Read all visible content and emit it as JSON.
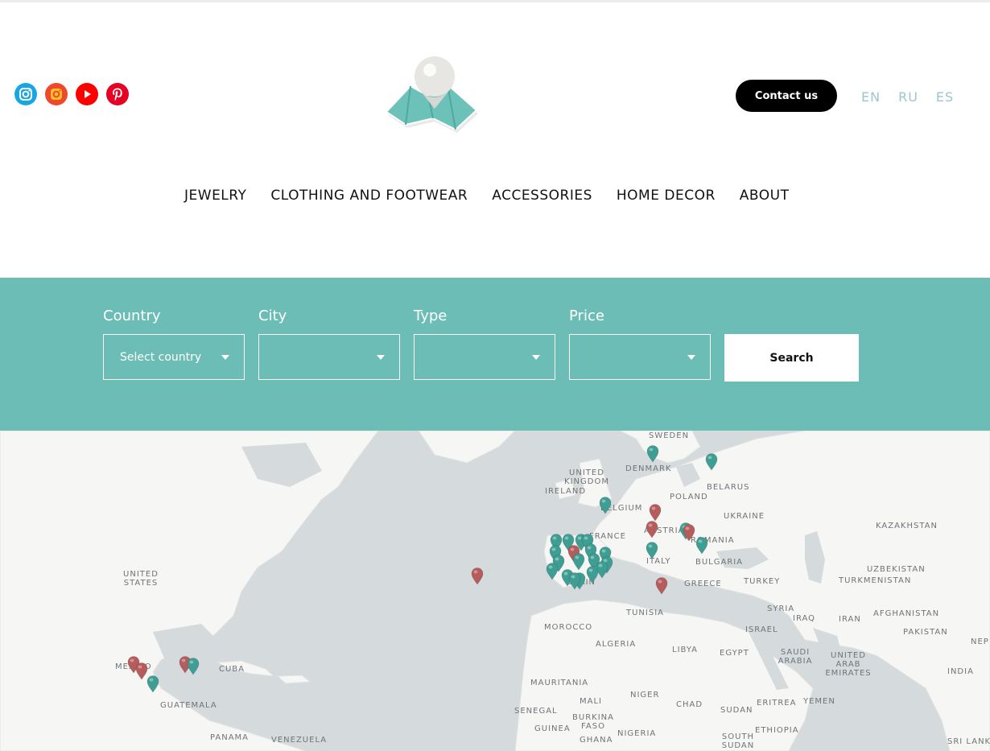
{
  "header": {
    "contact_label": "Contact us",
    "languages": [
      "EN",
      "RU",
      "ES"
    ]
  },
  "socials": [
    "instagram-icon",
    "instagram-color-icon",
    "youtube-icon",
    "pinterest-icon"
  ],
  "nav": [
    "JEWELRY",
    "CLOTHING AND FOOTWEAR",
    "ACCESSORIES",
    "HOME DECOR",
    "ABOUT"
  ],
  "filters": {
    "country_label": "Country",
    "country_value": "Select country",
    "city_label": "City",
    "city_value": "",
    "type_label": "Type",
    "type_value": "",
    "price_label": "Price",
    "price_value": "",
    "search_label": "Search"
  },
  "colors": {
    "accent": "#6dbdb7",
    "pin_teal": "#3f9e93",
    "pin_red": "#b65c5c",
    "map_water": "#d5dadd",
    "map_land": "#f6f6f4"
  },
  "map": {
    "labels": [
      "SWEDEN",
      "DENMARK",
      "UNITED KINGDOM",
      "IRELAND",
      "BELARUS",
      "POLAND",
      "BELGIUM",
      "UKRAINE",
      "KAZAKHSTAN",
      "FRANCE",
      "AUSTRIA",
      "ROMANIA",
      "BULGARIA",
      "ITALY",
      "UZBEKISTAN",
      "TURKMENISTAN",
      "UNITED STATES",
      "TURKEY",
      "GREECE",
      "SPAIN",
      "SYRIA",
      "IRAQ",
      "IRAN",
      "AFGHANISTAN",
      "TUNISIA",
      "ISRAEL",
      "PAKISTAN",
      "MOROCCO",
      "ALGERIA",
      "LIBYA",
      "EGYPT",
      "SAUDI ARABIA",
      "UNITED ARAB EMIRATES",
      "INDIA",
      "NEP",
      "MEXICO",
      "CUBA",
      "MAURITANIA",
      "MALI",
      "NIGER",
      "CHAD",
      "SUDAN",
      "ERITREA",
      "YEMEN",
      "GUATEMALA",
      "SENEGAL",
      "BURKINA FASO",
      "GUINEA",
      "NIGERIA",
      "ETHIOPIA",
      "PANAMA",
      "VENEZUELA",
      "GHANA",
      "SOUTH SUDAN",
      "SRI LANKA"
    ]
  }
}
